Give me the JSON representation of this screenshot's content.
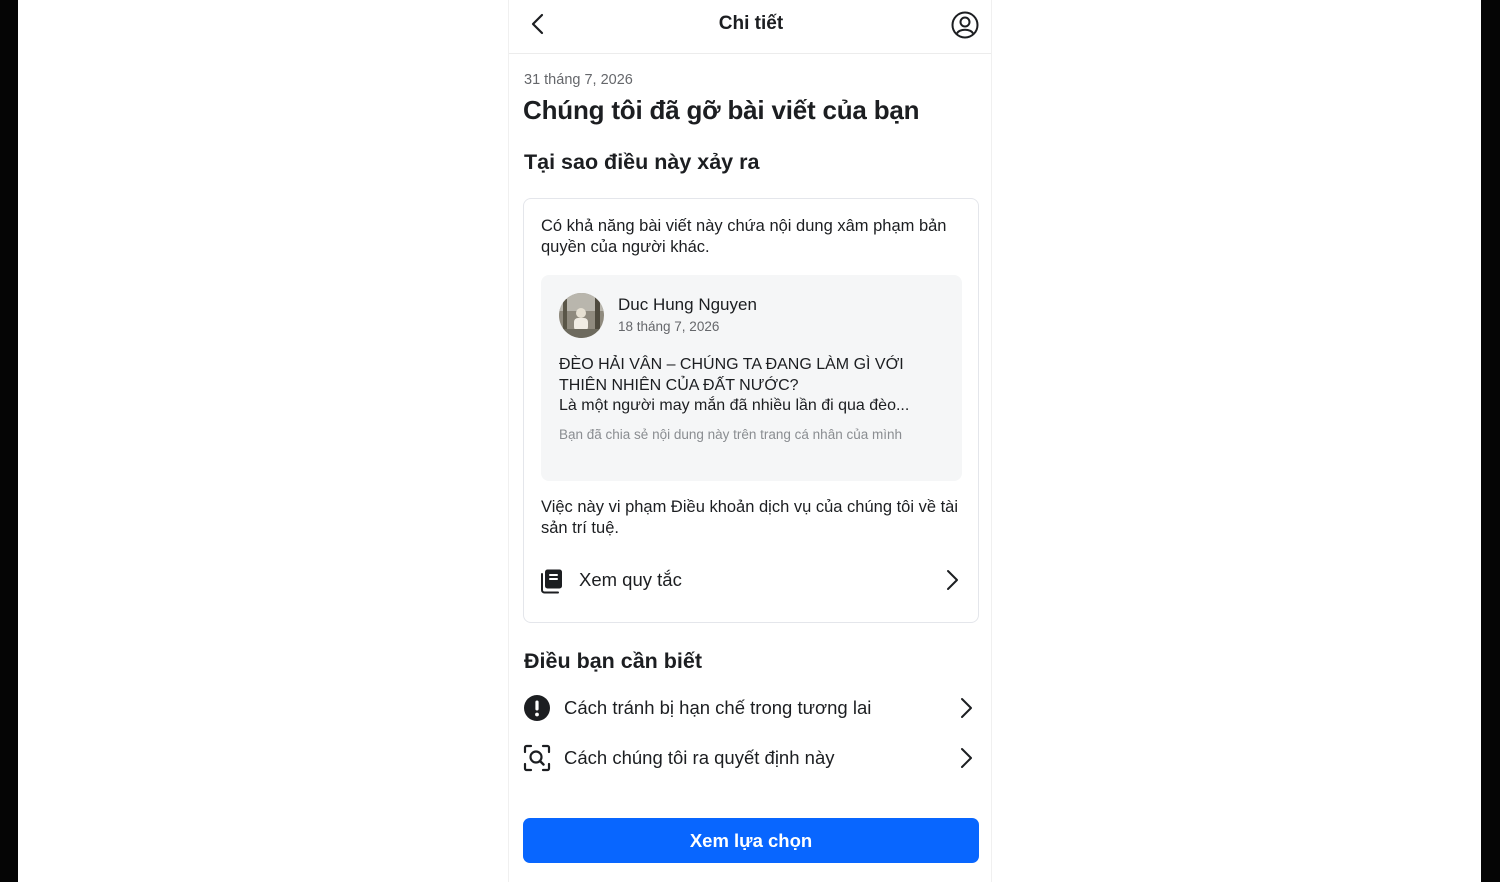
{
  "header": {
    "title": "Chi tiết",
    "back_icon": "chevron-left-icon",
    "account_icon": "user-circle-icon"
  },
  "notice": {
    "date": "31 tháng 7, 2026",
    "headline": "Chúng tôi đã gỡ bài viết của bạn"
  },
  "why": {
    "title": "Tại sao điều này xảy ra",
    "description": "Có khả năng bài viết này chứa nội dung xâm phạm bản quyền của người khác.",
    "post": {
      "author": "Duc Hung Nguyen",
      "date": "18 tháng 7, 2026",
      "text_line1": "ĐÈO HẢI VÂN – CHÚNG TA ĐANG LÀM GÌ VỚI",
      "text_line2": "THIÊN NHIÊN CỦA ĐẤT NƯỚC?",
      "text_line3": "Là một người may mắn đã nhiều lần đi qua đèo...",
      "share_note": "Bạn đã chia sẻ nội dung này trên trang cá nhân của mình"
    },
    "violation": "Việc này vi phạm Điều khoản dịch vụ của chúng tôi về tài sản trí tuệ.",
    "rules_link": "Xem quy tắc",
    "rules_icon": "book-icon"
  },
  "know": {
    "title": "Điều bạn cần biết",
    "items": [
      {
        "label": "Cách tránh bị hạn chế trong tương lai",
        "icon": "alert-circle-icon"
      },
      {
        "label": "Cách chúng tôi ra quyết định này",
        "icon": "scan-search-icon"
      }
    ]
  },
  "cta": {
    "label": "Xem lựa chọn",
    "color": "#0866ff"
  }
}
